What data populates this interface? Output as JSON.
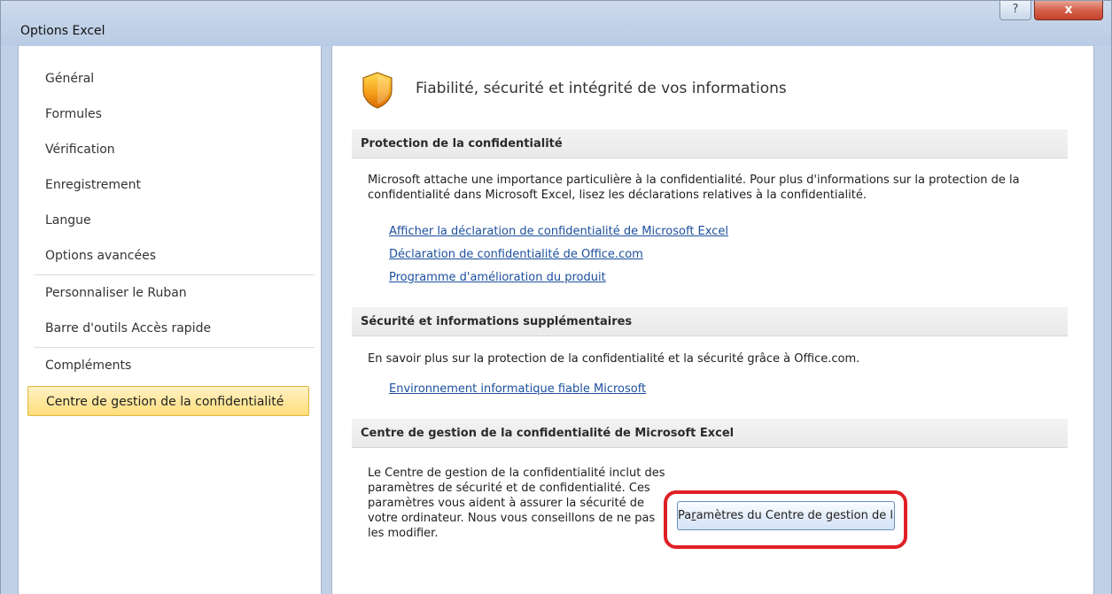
{
  "window": {
    "title": "Options Excel",
    "help_label": "?",
    "close_label": "x"
  },
  "sidebar": {
    "items": [
      {
        "label": "Général"
      },
      {
        "label": "Formules"
      },
      {
        "label": "Vérification"
      },
      {
        "label": "Enregistrement"
      },
      {
        "label": "Langue"
      },
      {
        "label": "Options avancées"
      },
      {
        "label": "Personnaliser le Ruban"
      },
      {
        "label": "Barre d'outils Accès rapide"
      },
      {
        "label": "Compléments"
      },
      {
        "label": "Centre de gestion de la confidentialité",
        "selected": true
      }
    ]
  },
  "main": {
    "heading": "Fiabilité, sécurité et intégrité de vos informations",
    "heading_icon": "shield-icon",
    "sections": [
      {
        "title": "Protection de la confidentialité",
        "text": "Microsoft attache une importance particulière à la confidentialité. Pour plus d'informations sur la protection de la confidentialité dans Microsoft Excel, lisez les déclarations relatives à la confidentialité.",
        "links": [
          "Afficher la déclaration de confidentialité de Microsoft Excel",
          "Déclaration de confidentialité de Office.com",
          "Programme d'amélioration du produit"
        ]
      },
      {
        "title": "Sécurité et informations supplémentaires",
        "text": "En savoir plus sur la protection de la confidentialité et la sécurité grâce à Office.com.",
        "links": [
          "Environnement informatique fiable Microsoft"
        ]
      },
      {
        "title": "Centre de gestion de la confidentialité de Microsoft Excel",
        "text": "Le Centre de gestion de la confidentialité inclut des paramètres de sécurité et de confidentialité. Ces paramètres vous aident à assurer la sécurité de votre ordinateur. Nous vous conseillons de ne pas les modifier.",
        "button_prefix": "Pa",
        "button_mnemonic": "r",
        "button_suffix": "amètres du Centre de gestion de la confidentialité..."
      }
    ]
  },
  "colors": {
    "highlight": "#e01f26",
    "selected_bg": "#ffde7a",
    "link": "#1c4f9c"
  }
}
